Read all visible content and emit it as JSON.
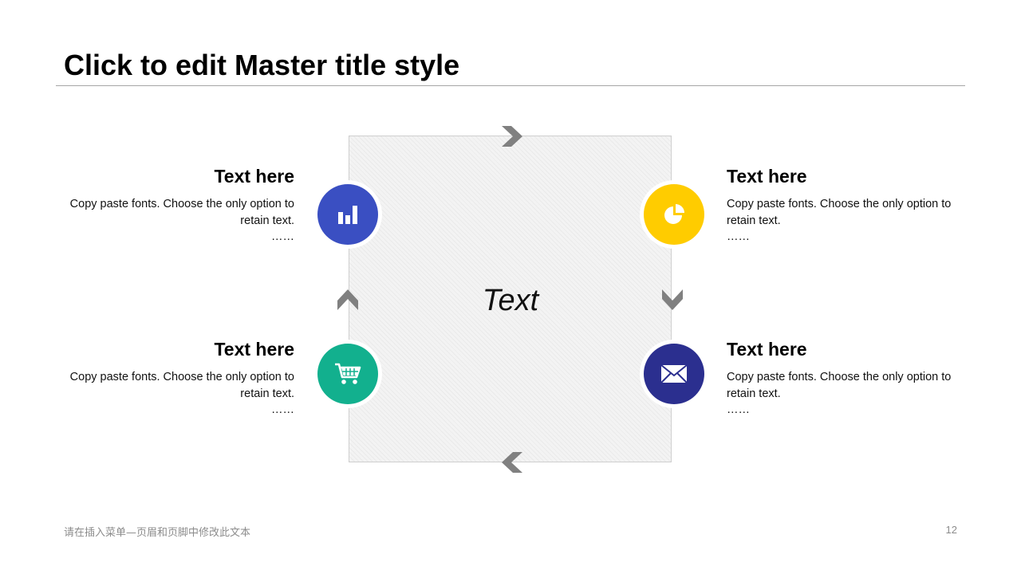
{
  "slide": {
    "title": "Click to edit Master title style",
    "center_text": "Text",
    "footer_text": "请在插入菜单—页眉和页脚中修改此文本",
    "page_number": "12"
  },
  "items": [
    {
      "heading": "Text here",
      "body": "Copy paste fonts. Choose the only option to retain text.",
      "ellipsis": "……",
      "icon": "bar-chart-icon",
      "color": "#3A4FC2"
    },
    {
      "heading": "Text here",
      "body": "Copy paste fonts. Choose the only option to retain text.",
      "ellipsis": "……",
      "icon": "pie-chart-icon",
      "color": "#FFCC00"
    },
    {
      "heading": "Text here",
      "body": "Copy paste fonts. Choose the only option to retain text.",
      "ellipsis": "……",
      "icon": "shopping-cart-icon",
      "color": "#12B08E"
    },
    {
      "heading": "Text here",
      "body": "Copy paste fonts. Choose the only option to retain text.",
      "ellipsis": "……",
      "icon": "envelope-icon",
      "color": "#2B2F8F"
    }
  ],
  "colors": {
    "arrow": "#808080",
    "title_rule": "#A6A6A6"
  }
}
